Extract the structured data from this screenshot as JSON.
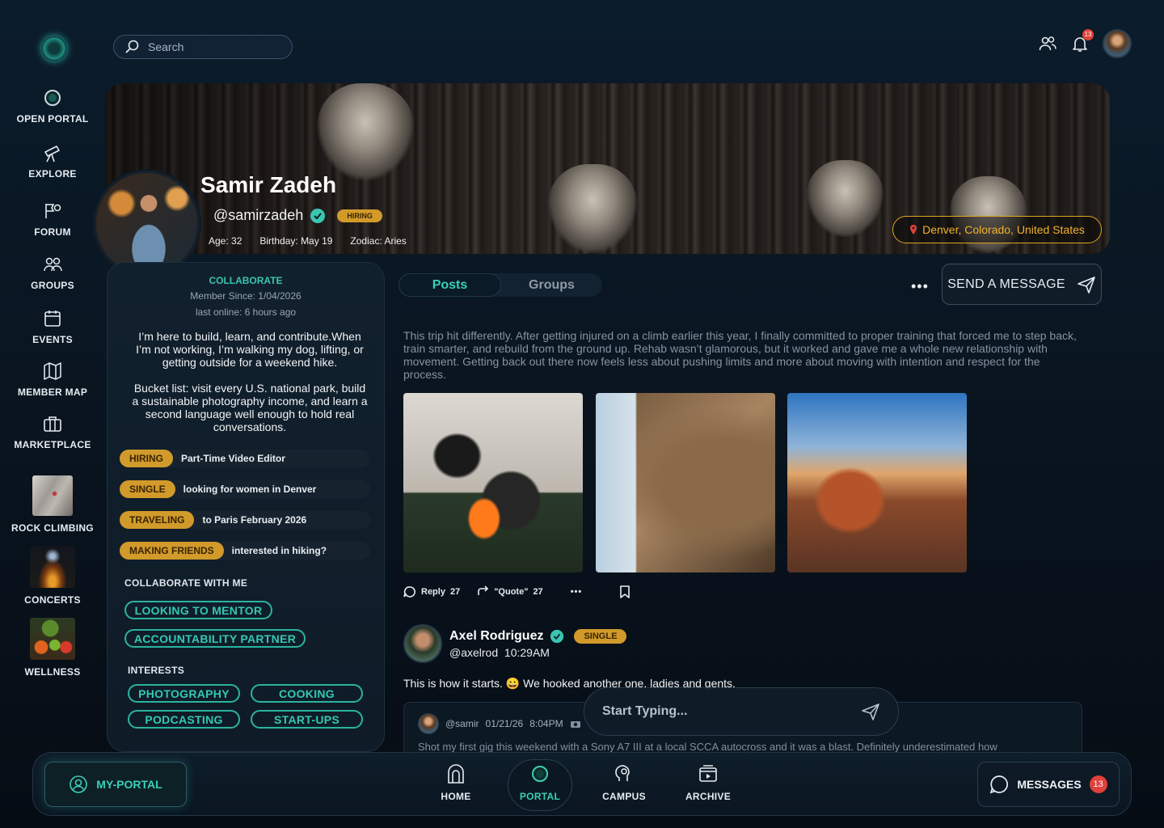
{
  "search": {
    "placeholder": "Search"
  },
  "header": {
    "notification_count": "13"
  },
  "sidebar": {
    "items": [
      {
        "label": "OPEN PORTAL"
      },
      {
        "label": "EXPLORE"
      },
      {
        "label": "FORUM"
      },
      {
        "label": "GROUPS"
      },
      {
        "label": "EVENTS"
      },
      {
        "label": "MEMBER MAP"
      },
      {
        "label": "MARKETPLACE"
      },
      {
        "label": "ROCK CLIMBING"
      },
      {
        "label": "CONCERTS"
      },
      {
        "label": "WELLNESS"
      }
    ]
  },
  "profile": {
    "name": "Samir Zadeh",
    "handle": "@samirzadeh",
    "hiring_badge": "HIRING",
    "age": "Age: 32",
    "birthday": "Birthday: May 19",
    "zodiac": "Zodiac: Aries",
    "location": "Denver, Colorado, United States",
    "collaborate_label": "COLLABORATE",
    "member_since": "Member Since: 1/04/2026",
    "last_online": "last online: 6 hours ago",
    "bio_1": "I’m here to build, learn, and contribute.When I’m not working, I’m walking my dog, lifting, or getting outside for a weekend hike.",
    "bio_2": "Bucket list: visit every U.S. national park, build a sustainable photography income, and learn a second language well enough to hold real conversations.",
    "statuses": [
      {
        "tag": "HIRING",
        "text": "Part-Time Video Editor"
      },
      {
        "tag": "SINGLE",
        "text": "looking for women in Denver"
      },
      {
        "tag": "TRAVELING",
        "text": "to Paris February 2026"
      },
      {
        "tag": "MAKING FRIENDS",
        "text": "interested in hiking?"
      }
    ],
    "collaborate_with_me_label": "COLLABORATE WITH ME",
    "collaborate_with_me": [
      "LOOKING TO MENTOR",
      "ACCOUNTABILITY PARTNER"
    ],
    "interests_label": "INTERESTS",
    "interests": [
      "PHOTOGRAPHY",
      "COOKING",
      "PODCASTING",
      "START-UPS"
    ]
  },
  "tabs": [
    {
      "label": "Posts"
    },
    {
      "label": "Groups"
    }
  ],
  "send_message_label": "SEND A MESSAGE",
  "more_label": "•••",
  "post1": {
    "text": "This trip hit differently. After getting injured on a climb earlier this year, I finally committed to proper training that forced me to step back, train smarter, and rebuild from the ground up. Rehab wasn’t glamorous, but it worked and gave me a whole new relationship with movement. Getting back out there now feels less about pushing limits and more about moving with intention and respect for the process.",
    "reply_label": "Reply",
    "reply_count": "27",
    "quote_label": "\"Quote\"",
    "quote_count": "27"
  },
  "post2": {
    "author": "Axel Rodriguez",
    "badge": "SINGLE",
    "handle": "@axelrod",
    "time": "10:29AM",
    "text": "This is how it starts. 😀 We hooked another one, ladies and gents."
  },
  "quote": {
    "handle": "@samir",
    "date": "01/21/26",
    "time": "8:04PM",
    "text": "Shot my first gig this weekend with a Sony A7 III at a local SCCA autocross and it was a blast. Definitely underestimated how"
  },
  "composer": {
    "placeholder": "Start Typing..."
  },
  "bottom_nav": {
    "my_portal": "MY-PORTAL",
    "items": [
      {
        "label": "HOME"
      },
      {
        "label": "PORTAL"
      },
      {
        "label": "CAMPUS"
      },
      {
        "label": "ARCHIVE"
      }
    ],
    "messages_label": "MESSAGES",
    "messages_count": "13"
  },
  "colors": {
    "accent": "#3ad0b5",
    "gold": "#d19a2a",
    "alert": "#e0413a",
    "background": "#0b1c2b"
  }
}
